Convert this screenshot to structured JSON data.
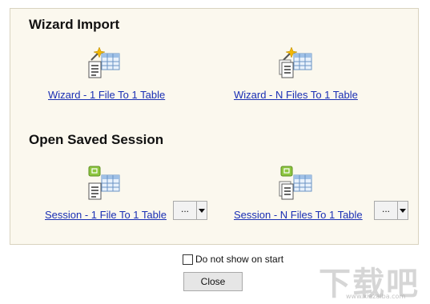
{
  "wizard_section": {
    "title": "Wizard Import",
    "options": [
      {
        "label": "Wizard - 1 File To 1 Table",
        "icon": "wizard-single-file-table-icon"
      },
      {
        "label": "Wizard - N Files To 1 Table ",
        "icon": "wizard-multi-file-table-icon"
      }
    ]
  },
  "session_section": {
    "title": "Open Saved Session",
    "options": [
      {
        "label": "Session - 1 File To 1 Table",
        "icon": "session-single-file-table-icon",
        "more_label": "..."
      },
      {
        "label": "Session - N Files To 1 Table",
        "icon": "session-multi-file-table-icon",
        "more_label": "..."
      }
    ]
  },
  "footer": {
    "checkbox_label": "Do not show on start",
    "checkbox_checked": false,
    "close_label": "Close"
  },
  "colors": {
    "panel_bg": "#fbf8ee",
    "link": "#1a2fb4",
    "session_badge": "#8dc63f",
    "wand": "#f2b705"
  },
  "watermark": {
    "text": "下载吧",
    "sub": "www.xiazaiba.com"
  }
}
